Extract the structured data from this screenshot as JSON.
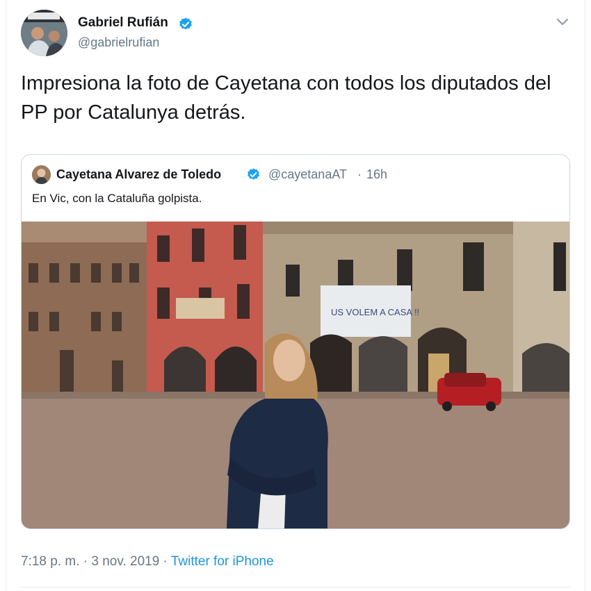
{
  "tweet": {
    "author_name": "Gabriel Rufián",
    "author_handle": "@gabrielrufian",
    "text": "Impresiona la foto de Cayetana con todos los diputados del PP por Catalunya detrás.",
    "timestamp": "7:18 p. m. · 3 nov. 2019",
    "separator": " · ",
    "source": "Twitter for iPhone",
    "verified_icon": "verified-badge-icon",
    "menu_icon": "chevron-down-icon"
  },
  "quote": {
    "author_name": "Cayetana Alvarez de Toledo",
    "author_handle": "@cayetanaAT",
    "dot": "·",
    "time": "16h",
    "text": "En Vic, con la Cataluña golpista.",
    "photo_banner_text": "US VOLEM A CASA !!"
  },
  "colors": {
    "verified": "#1da1f2",
    "link": "#1b95e0",
    "secondary_text": "#657786",
    "border": "#ccd6dd"
  }
}
